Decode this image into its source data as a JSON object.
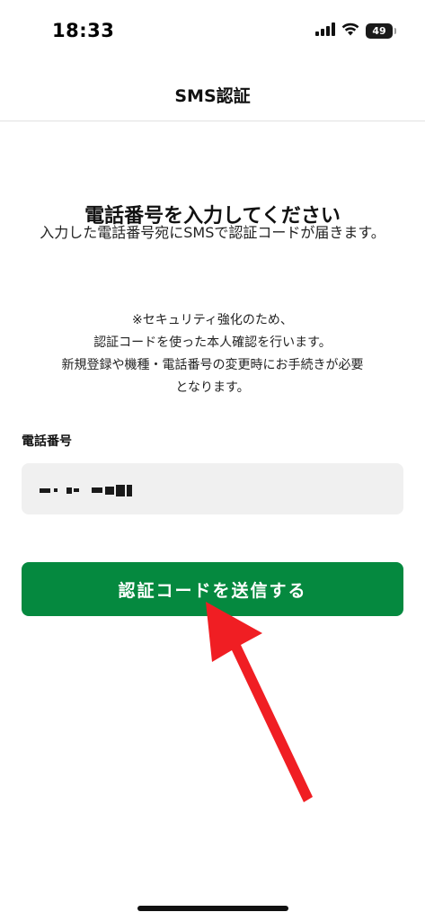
{
  "status_bar": {
    "time": "18:33",
    "battery_level": "49",
    "icons": [
      "signal-icon",
      "wifi-icon",
      "battery-icon"
    ]
  },
  "nav": {
    "title": "SMS認証"
  },
  "content": {
    "heading": "電話番号を入力してください",
    "description": "入力した電話番号宛にSMSで認証コードが届きます。",
    "notice_lines": [
      "※セキュリティ強化のため、",
      "認証コードを使った本人確認を行います。",
      "新規登録や機種・電話番号の変更時にお手続きが必要",
      "となります。"
    ]
  },
  "phone_field": {
    "label": "電話番号",
    "value_redacted": true
  },
  "button": {
    "label": "認証コードを送信する"
  },
  "colors": {
    "primary": "#05893f",
    "field_background": "#f0f0f0",
    "annotation_arrow": "#f01e23"
  }
}
